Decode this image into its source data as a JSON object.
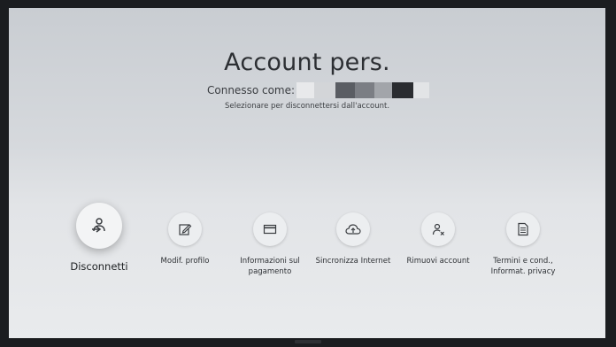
{
  "header": {
    "title": "Account pers.",
    "connected_label": "Connesso come:",
    "hint": "Selezionare per disconnettersi dall'account."
  },
  "actions": [
    {
      "id": "disconnect",
      "label": "Disconnetti",
      "icon": "person-logout-icon"
    },
    {
      "id": "edit-profile",
      "label": "Modif. profilo",
      "icon": "edit-icon"
    },
    {
      "id": "payment-info",
      "label_lines": [
        "Informazioni sul",
        "pagamento"
      ],
      "icon": "credit-card-icon"
    },
    {
      "id": "sync-internet",
      "label": "Sincronizza Internet",
      "icon": "cloud-upload-icon"
    },
    {
      "id": "remove-account",
      "label": "Rimuovi account",
      "icon": "person-remove-icon"
    },
    {
      "id": "terms",
      "label_lines": [
        "Termini e cond.,",
        "Informat. privacy"
      ],
      "icon": "document-icon"
    }
  ],
  "colors": {
    "screen_top": "#c9cdd2",
    "screen_bottom": "#e9ebed",
    "text": "#2c2f33",
    "bezel": "#1b1d20"
  }
}
